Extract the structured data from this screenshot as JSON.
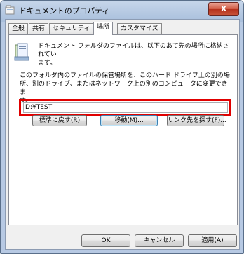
{
  "window": {
    "title": "ドキュメントのプロパティ",
    "close_label": "X"
  },
  "tabs": [
    {
      "label": "全般"
    },
    {
      "label": "共有"
    },
    {
      "label": "セキュリティ"
    },
    {
      "label": "場所"
    },
    {
      "label": "カスタマイズ"
    }
  ],
  "active_tab": "場所",
  "location": {
    "description_line1": "ドキュメント フォルダのファイルは、以下のあて先の場所に格納されてい",
    "description_line2": "ます。",
    "info_line1": "このフォルダ内のファイルの保管場所を、このハード ドライブ上の別の場",
    "info_line2": "所、別のドライブ、またはネットワーク上の別のコンピュータに変更できま",
    "info_line3": "す。",
    "path_value": "D:¥TEST",
    "restore_default_label": "標準に戻す(R)",
    "move_label": "移動(M)...",
    "find_target_label": "リンク先を探す(F)..."
  },
  "footer": {
    "ok_label": "OK",
    "cancel_label": "キャンセル",
    "apply_label": "適用(A)"
  }
}
